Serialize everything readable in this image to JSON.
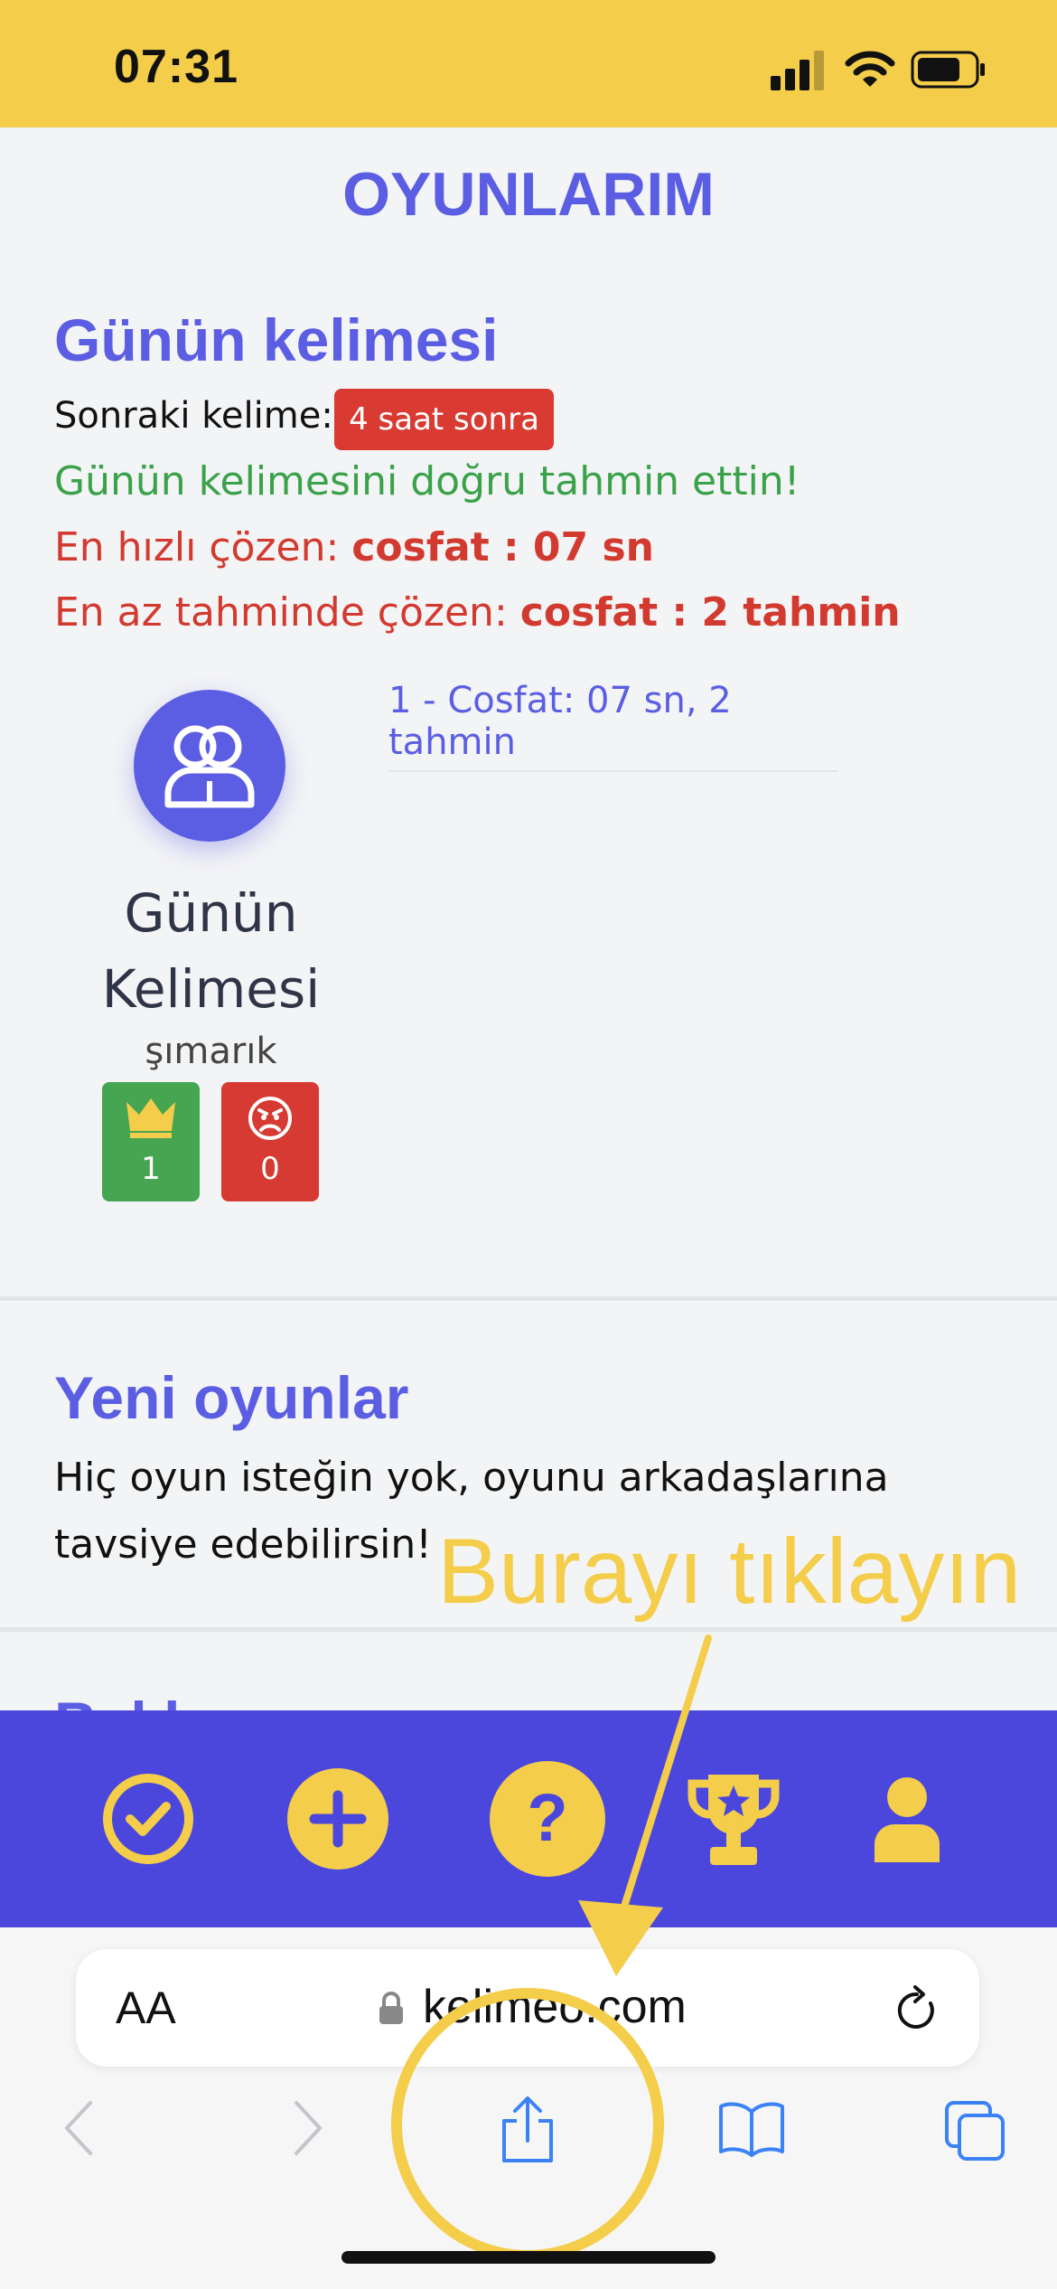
{
  "status_bar": {
    "time": "07:31"
  },
  "page": {
    "title": "OYUNLARIM"
  },
  "daily_word": {
    "section_title": "Günün kelimesi",
    "next_word_label": "Sonraki kelime:",
    "next_word_badge": "4 saat sonra",
    "success_message": "Günün kelimesini doğru tahmin ettin!",
    "fastest_label": "En hızlı çözen: ",
    "fastest_value": "cosfat : 07 sn",
    "fewest_label": "En az tahminde çözen: ",
    "fewest_value": "cosfat : 2 tahmin",
    "leaderboard_entry": "1 - Cosfat: 07 sn, 2 tahmin",
    "game_name": "Günün Kelimesi",
    "game_word": "şımarık",
    "wins": "1",
    "losses": "0"
  },
  "new_games": {
    "section_title": "Yeni oyunlar",
    "message": "Hiç oyun isteğin yok, oyunu arkadaşlarına tavsiye edebilirsin!"
  },
  "partial_section": {
    "title": "Bekleyen"
  },
  "annotation": {
    "text": "Burayı tıklayın",
    "color": "#f4cd4a"
  },
  "bottom_nav": {
    "items": [
      {
        "icon": "check-circle-icon"
      },
      {
        "icon": "plus-circle-icon"
      },
      {
        "icon": "question-circle-icon"
      },
      {
        "icon": "trophy-icon"
      },
      {
        "icon": "user-icon"
      }
    ],
    "background": "#4b47dc",
    "icon_color": "#f4cd4a"
  },
  "browser": {
    "text_size_label": "AA",
    "url": "kelimeo.com"
  },
  "colors": {
    "accent": "#5b5ee3",
    "status_bar": "#f4cd4a",
    "success": "#3aa24b",
    "danger": "#d33a2f"
  }
}
